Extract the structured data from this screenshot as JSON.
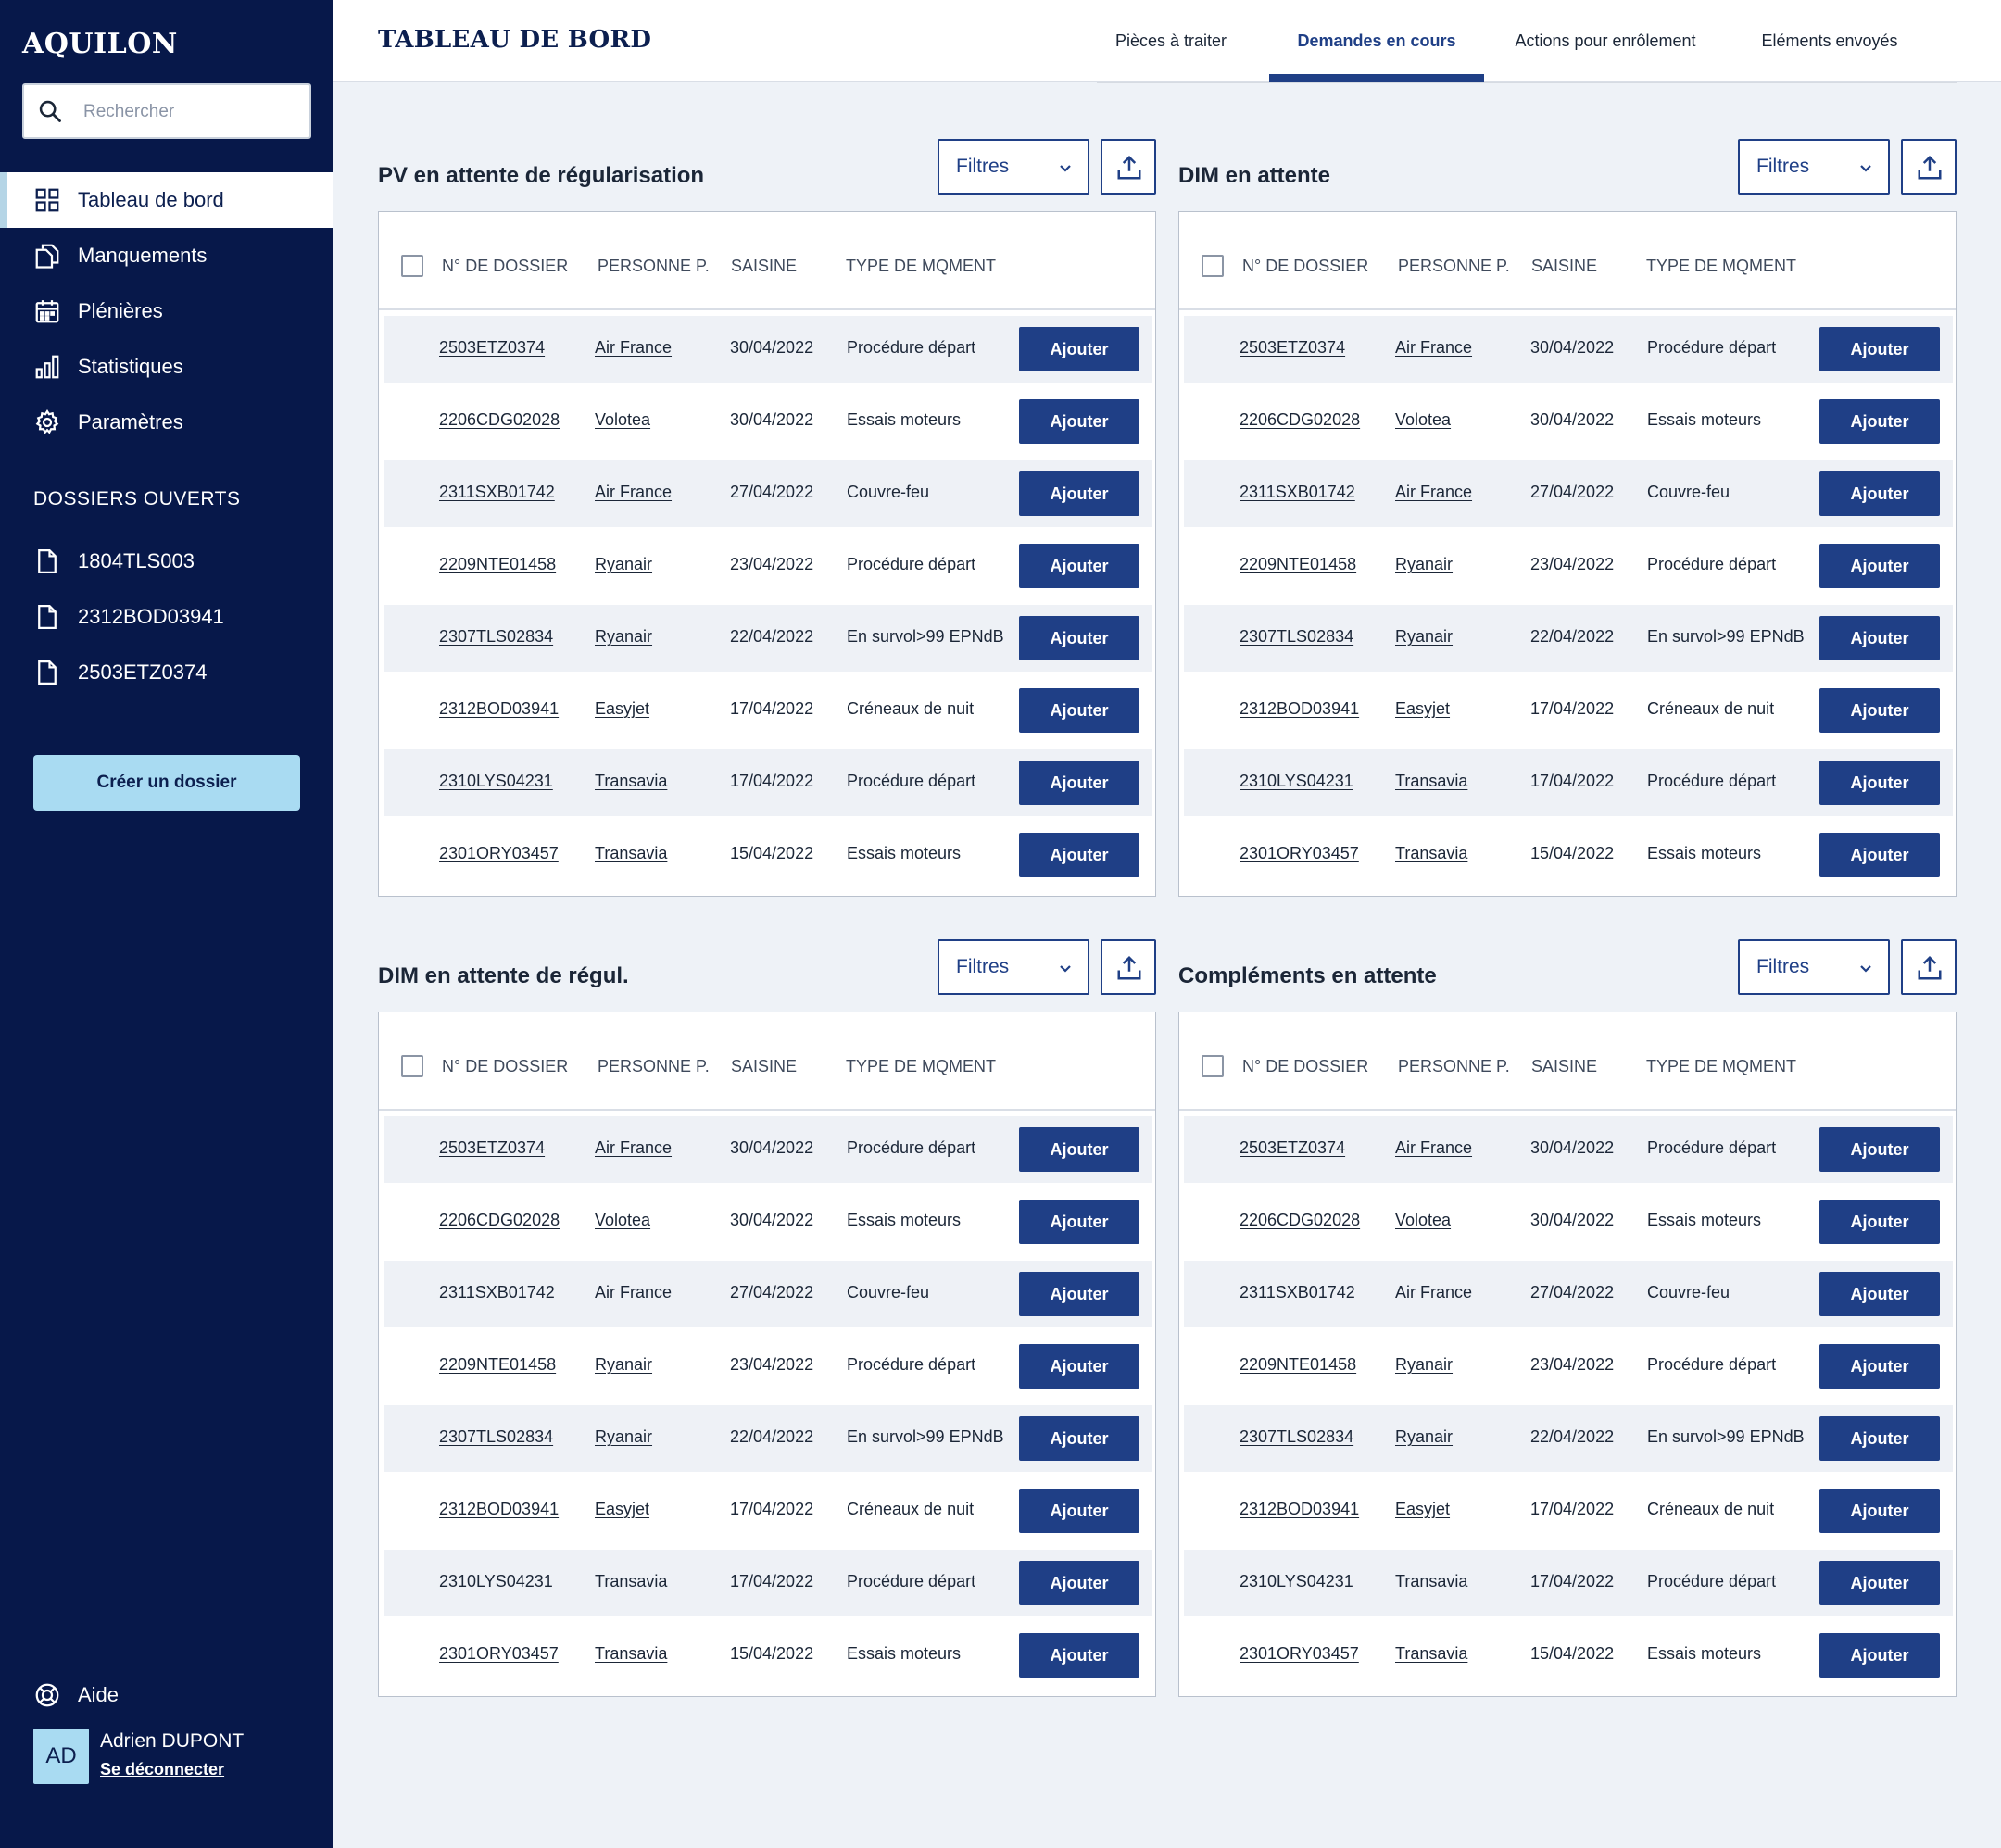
{
  "app": {
    "logo": "AQUILON"
  },
  "search": {
    "placeholder": "Rechercher"
  },
  "sidebar": {
    "nav": [
      {
        "label": "Tableau de bord",
        "icon": "grid-icon",
        "active": true
      },
      {
        "label": "Manquements",
        "icon": "copy-icon"
      },
      {
        "label": "Plénières",
        "icon": "calendar-icon"
      },
      {
        "label": "Statistiques",
        "icon": "bar-chart-icon"
      },
      {
        "label": "Paramètres",
        "icon": "gear-icon"
      }
    ],
    "section_title": "DOSSIERS OUVERTS",
    "open_files": [
      "1804TLS003",
      "2312BOD03941",
      "2503ETZ0374"
    ],
    "create_label": "Créer un dossier",
    "help_label": "Aide",
    "user": {
      "initials": "AD",
      "name": "Adrien DUPONT",
      "logout": "Se déconnecter"
    }
  },
  "header": {
    "title": "TABLEAU DE BORD",
    "tabs": [
      {
        "label": "Pièces à traiter"
      },
      {
        "label": "Demandes en cours",
        "active": true
      },
      {
        "label": "Actions pour enrôlement"
      },
      {
        "label": "Eléments envoyés"
      }
    ]
  },
  "table": {
    "columns": [
      "N° DE DOSSIER",
      "PERSONNE P.",
      "SAISINE",
      "TYPE DE MQMENT"
    ],
    "action_label": "Ajouter",
    "filter_label": "Filtres",
    "rows": [
      {
        "dossier": "2503ETZ0374",
        "personne": "Air France",
        "saisine": "30/04/2022",
        "type": "Procédure départ"
      },
      {
        "dossier": "2206CDG02028",
        "personne": "Volotea",
        "saisine": "30/04/2022",
        "type": "Essais moteurs"
      },
      {
        "dossier": "2311SXB01742",
        "personne": "Air France",
        "saisine": "27/04/2022",
        "type": "Couvre-feu"
      },
      {
        "dossier": "2209NTE01458",
        "personne": "Ryanair",
        "saisine": "23/04/2022",
        "type": "Procédure départ"
      },
      {
        "dossier": "2307TLS02834",
        "personne": "Ryanair",
        "saisine": "22/04/2022",
        "type": "En survol>99 EPNdB"
      },
      {
        "dossier": "2312BOD03941",
        "personne": "Easyjet",
        "saisine": "17/04/2022",
        "type": "Créneaux de nuit"
      },
      {
        "dossier": "2310LYS04231",
        "personne": "Transavia",
        "saisine": "17/04/2022",
        "type": "Procédure départ"
      },
      {
        "dossier": "2301ORY03457",
        "personne": "Transavia",
        "saisine": "15/04/2022",
        "type": "Essais moteurs"
      }
    ]
  },
  "panels": [
    {
      "title": "PV en attente de régularisation"
    },
    {
      "title": "DIM en attente"
    },
    {
      "title": "DIM en attente de régul."
    },
    {
      "title": "Compléments en attente"
    }
  ],
  "colors": {
    "navy": "#07184a",
    "primary": "#1f3f86",
    "accent": "#a9dbf2",
    "background": "#eef2f7"
  }
}
